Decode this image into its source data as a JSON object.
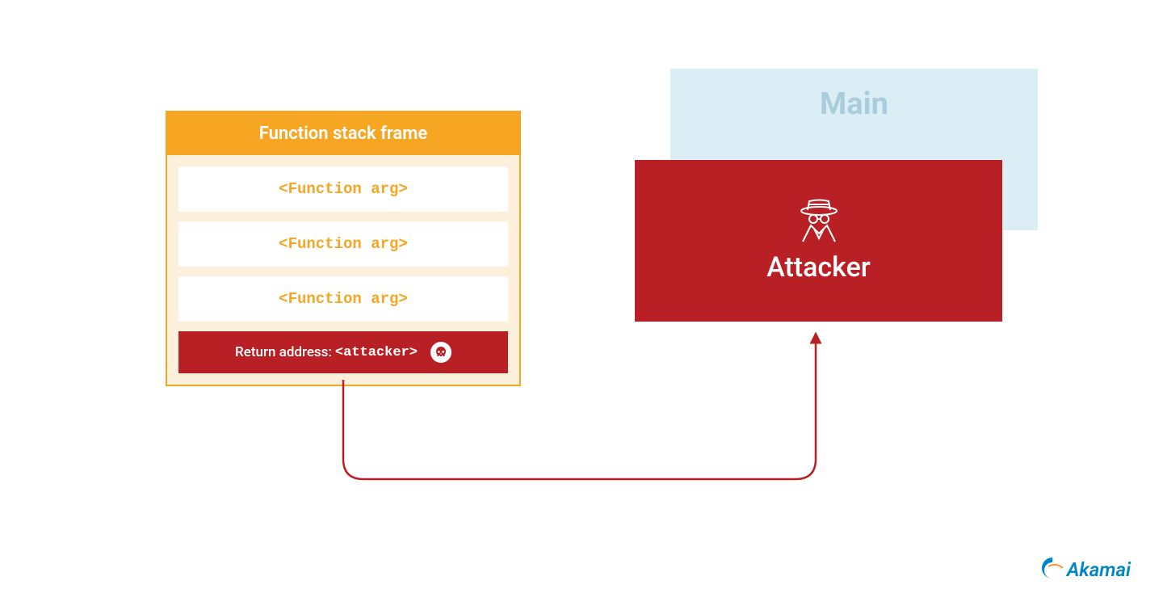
{
  "stack": {
    "header": "Function stack frame",
    "args": [
      "<Function arg>",
      "<Function arg>",
      "<Function arg>"
    ],
    "return_label": "Return address:",
    "return_value": "<attacker>"
  },
  "main": {
    "label": "Main"
  },
  "attacker": {
    "label": "Attacker"
  },
  "logo": {
    "text": "Akamai"
  },
  "colors": {
    "orange": "#f6a623",
    "orange_light": "#fcefdc",
    "red": "#b92025",
    "blue_light": "#dbeef6",
    "blue_faded": "#a9cddd",
    "akamai_blue": "#0086c7",
    "akamai_orange": "#ff9933"
  }
}
